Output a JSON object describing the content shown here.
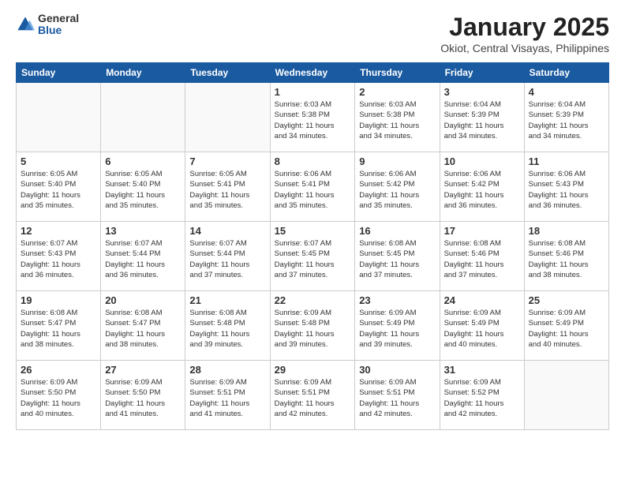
{
  "header": {
    "logo_general": "General",
    "logo_blue": "Blue",
    "title": "January 2025",
    "subtitle": "Okiot, Central Visayas, Philippines"
  },
  "weekdays": [
    "Sunday",
    "Monday",
    "Tuesday",
    "Wednesday",
    "Thursday",
    "Friday",
    "Saturday"
  ],
  "weeks": [
    [
      {
        "day": "",
        "info": ""
      },
      {
        "day": "",
        "info": ""
      },
      {
        "day": "",
        "info": ""
      },
      {
        "day": "1",
        "info": "Sunrise: 6:03 AM\nSunset: 5:38 PM\nDaylight: 11 hours\nand 34 minutes."
      },
      {
        "day": "2",
        "info": "Sunrise: 6:03 AM\nSunset: 5:38 PM\nDaylight: 11 hours\nand 34 minutes."
      },
      {
        "day": "3",
        "info": "Sunrise: 6:04 AM\nSunset: 5:39 PM\nDaylight: 11 hours\nand 34 minutes."
      },
      {
        "day": "4",
        "info": "Sunrise: 6:04 AM\nSunset: 5:39 PM\nDaylight: 11 hours\nand 34 minutes."
      }
    ],
    [
      {
        "day": "5",
        "info": "Sunrise: 6:05 AM\nSunset: 5:40 PM\nDaylight: 11 hours\nand 35 minutes."
      },
      {
        "day": "6",
        "info": "Sunrise: 6:05 AM\nSunset: 5:40 PM\nDaylight: 11 hours\nand 35 minutes."
      },
      {
        "day": "7",
        "info": "Sunrise: 6:05 AM\nSunset: 5:41 PM\nDaylight: 11 hours\nand 35 minutes."
      },
      {
        "day": "8",
        "info": "Sunrise: 6:06 AM\nSunset: 5:41 PM\nDaylight: 11 hours\nand 35 minutes."
      },
      {
        "day": "9",
        "info": "Sunrise: 6:06 AM\nSunset: 5:42 PM\nDaylight: 11 hours\nand 35 minutes."
      },
      {
        "day": "10",
        "info": "Sunrise: 6:06 AM\nSunset: 5:42 PM\nDaylight: 11 hours\nand 36 minutes."
      },
      {
        "day": "11",
        "info": "Sunrise: 6:06 AM\nSunset: 5:43 PM\nDaylight: 11 hours\nand 36 minutes."
      }
    ],
    [
      {
        "day": "12",
        "info": "Sunrise: 6:07 AM\nSunset: 5:43 PM\nDaylight: 11 hours\nand 36 minutes."
      },
      {
        "day": "13",
        "info": "Sunrise: 6:07 AM\nSunset: 5:44 PM\nDaylight: 11 hours\nand 36 minutes."
      },
      {
        "day": "14",
        "info": "Sunrise: 6:07 AM\nSunset: 5:44 PM\nDaylight: 11 hours\nand 37 minutes."
      },
      {
        "day": "15",
        "info": "Sunrise: 6:07 AM\nSunset: 5:45 PM\nDaylight: 11 hours\nand 37 minutes."
      },
      {
        "day": "16",
        "info": "Sunrise: 6:08 AM\nSunset: 5:45 PM\nDaylight: 11 hours\nand 37 minutes."
      },
      {
        "day": "17",
        "info": "Sunrise: 6:08 AM\nSunset: 5:46 PM\nDaylight: 11 hours\nand 37 minutes."
      },
      {
        "day": "18",
        "info": "Sunrise: 6:08 AM\nSunset: 5:46 PM\nDaylight: 11 hours\nand 38 minutes."
      }
    ],
    [
      {
        "day": "19",
        "info": "Sunrise: 6:08 AM\nSunset: 5:47 PM\nDaylight: 11 hours\nand 38 minutes."
      },
      {
        "day": "20",
        "info": "Sunrise: 6:08 AM\nSunset: 5:47 PM\nDaylight: 11 hours\nand 38 minutes."
      },
      {
        "day": "21",
        "info": "Sunrise: 6:08 AM\nSunset: 5:48 PM\nDaylight: 11 hours\nand 39 minutes."
      },
      {
        "day": "22",
        "info": "Sunrise: 6:09 AM\nSunset: 5:48 PM\nDaylight: 11 hours\nand 39 minutes."
      },
      {
        "day": "23",
        "info": "Sunrise: 6:09 AM\nSunset: 5:49 PM\nDaylight: 11 hours\nand 39 minutes."
      },
      {
        "day": "24",
        "info": "Sunrise: 6:09 AM\nSunset: 5:49 PM\nDaylight: 11 hours\nand 40 minutes."
      },
      {
        "day": "25",
        "info": "Sunrise: 6:09 AM\nSunset: 5:49 PM\nDaylight: 11 hours\nand 40 minutes."
      }
    ],
    [
      {
        "day": "26",
        "info": "Sunrise: 6:09 AM\nSunset: 5:50 PM\nDaylight: 11 hours\nand 40 minutes."
      },
      {
        "day": "27",
        "info": "Sunrise: 6:09 AM\nSunset: 5:50 PM\nDaylight: 11 hours\nand 41 minutes."
      },
      {
        "day": "28",
        "info": "Sunrise: 6:09 AM\nSunset: 5:51 PM\nDaylight: 11 hours\nand 41 minutes."
      },
      {
        "day": "29",
        "info": "Sunrise: 6:09 AM\nSunset: 5:51 PM\nDaylight: 11 hours\nand 42 minutes."
      },
      {
        "day": "30",
        "info": "Sunrise: 6:09 AM\nSunset: 5:51 PM\nDaylight: 11 hours\nand 42 minutes."
      },
      {
        "day": "31",
        "info": "Sunrise: 6:09 AM\nSunset: 5:52 PM\nDaylight: 11 hours\nand 42 minutes."
      },
      {
        "day": "",
        "info": ""
      }
    ]
  ]
}
